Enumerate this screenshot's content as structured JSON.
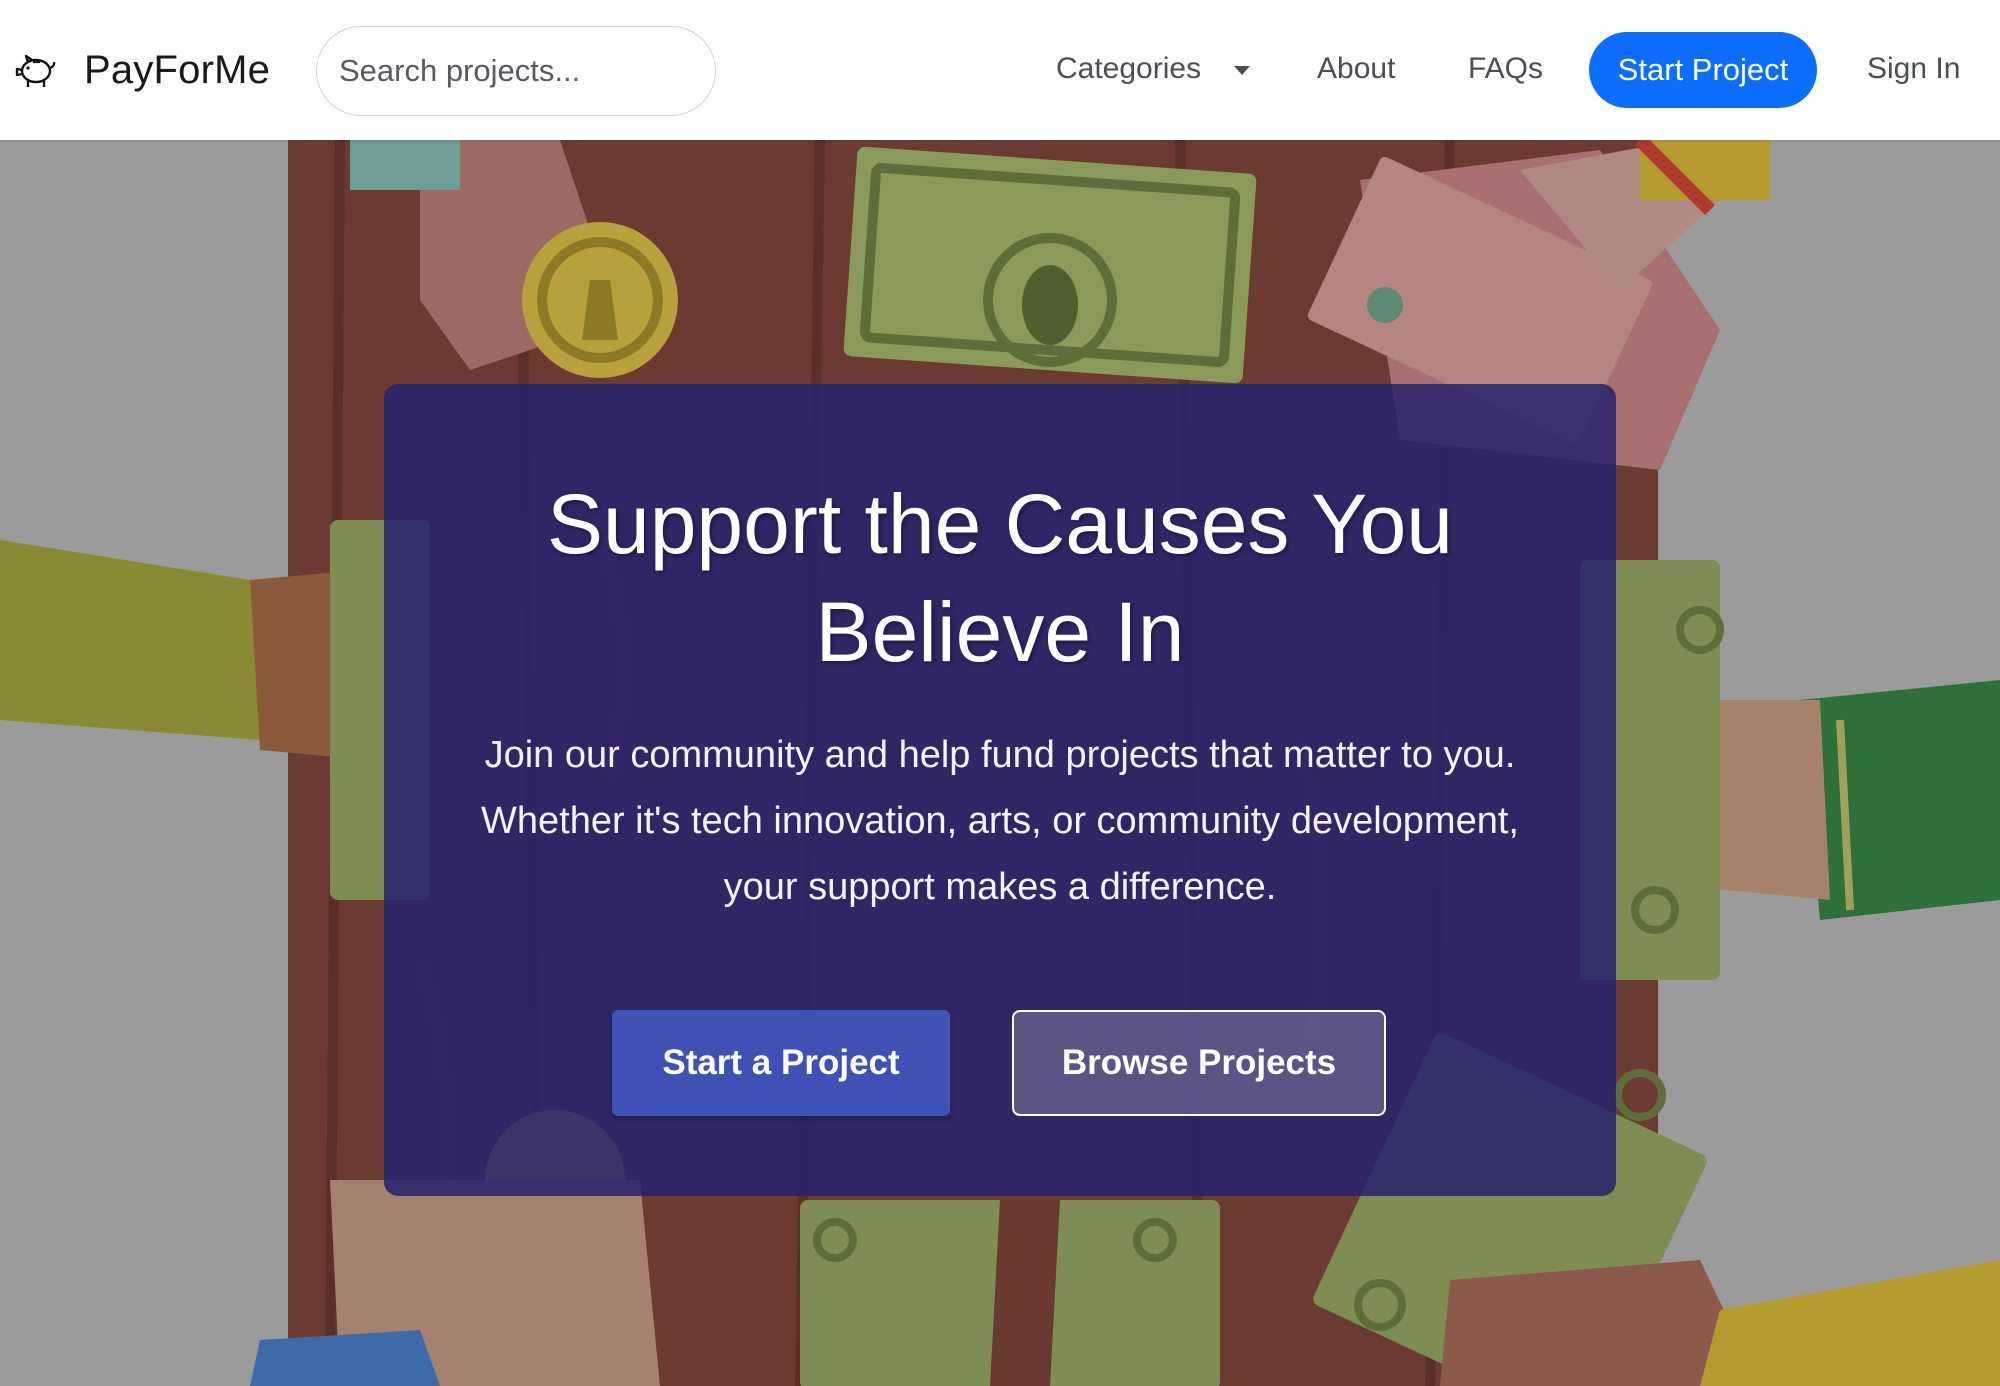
{
  "navbar": {
    "brand": {
      "name": "PayForMe",
      "icon": "piggy-bank-icon"
    },
    "search": {
      "placeholder": "Search projects..."
    },
    "links": {
      "categories": "Categories",
      "about": "About",
      "faqs": "FAQs",
      "start_project": "Start Project",
      "sign_in": "Sign In"
    },
    "accent_color": "#0d6efd"
  },
  "hero": {
    "title": "Support the Causes You Believe In",
    "text": "Join our community and help fund projects that matter to you. Whether it's tech innovation, arts, or community development, your support makes a difference.",
    "primary_button": "Start a Project",
    "secondary_button": "Browse Projects",
    "background_art": "crowdfunding-hands-money-illustration",
    "card_color": "#26226e",
    "primary_button_color": "#3f51b5"
  }
}
